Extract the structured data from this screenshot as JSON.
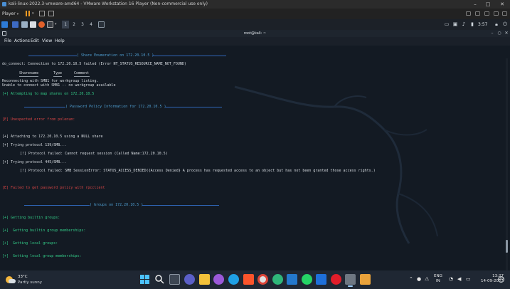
{
  "vmware": {
    "title": "kali-linux-2022.3-vmware-amd64 - VMware Workstation 16 Player (Non-commercial use only)",
    "player_label": "Player"
  },
  "kali_panel": {
    "workspaces": [
      "1",
      "2",
      "3",
      "4"
    ],
    "clock": "3:57"
  },
  "terminal": {
    "title": "root@kali: ~",
    "menu": [
      "File",
      "Actions",
      "Edit",
      "View",
      "Help"
    ],
    "share_header": "( Share Enumeration on 172.20.10.5 )",
    "line_doconnect": "do_connect: Connection to 172.20.10.5 failed (Error NT_STATUS_RESOURCE_NAME_NOT_FOUND)",
    "col_sharename": "Sharename",
    "col_type": "Type",
    "col_comment": "Comment",
    "line_reconnect": "Reconnecting with SMB1 for workgroup listing.",
    "line_unable": "Unable to connect with SMB1 -- no workgroup available",
    "line_map": "[+] Attempting to map shares on 172.20.10.5",
    "policy_header": "( Password Policy Information for 172.20.10.5 )",
    "line_unexpected": "[E] Unexpected error from polenum:",
    "line_null": "[+] Attaching to 172.20.10.5 using a NULL share",
    "line_try139": "[+] Trying protocol 139/SMB...",
    "line_fail139": "[!] Protocol failed: Cannot request session (Called Name:172.20.10.5)",
    "line_try445": "[+] Trying protocol 445/SMB...",
    "line_fail445": "[!] Protocol failed: SMB SessionError: STATUS_ACCESS_DENIED({Access Denied} A process has requested access to an object but has not been granted those access rights.)",
    "line_failpw": "[E] Failed to get password policy with rpcclient",
    "groups_header": "( Groups on 172.20.10.5 )",
    "line_builtin": "[+] Getting builtin groups:",
    "line_builtin_mem": "[+]  Getting builtin group memberships:",
    "line_local": "[+]  Getting local groups:",
    "line_local_mem": "[+]  Getting local group memberships:"
  },
  "taskbar": {
    "temp": "33°C",
    "weather": "Partly sunny",
    "lang_top": "ENG",
    "lang_bottom": "IN",
    "time": "13:27",
    "date": "14-09-2022",
    "notification_count": "20"
  },
  "colors": {
    "terminal_bg": "#131a23",
    "header_blue": "#4f9fd2",
    "error_red": "#d64545",
    "info_green": "#33cc88"
  }
}
